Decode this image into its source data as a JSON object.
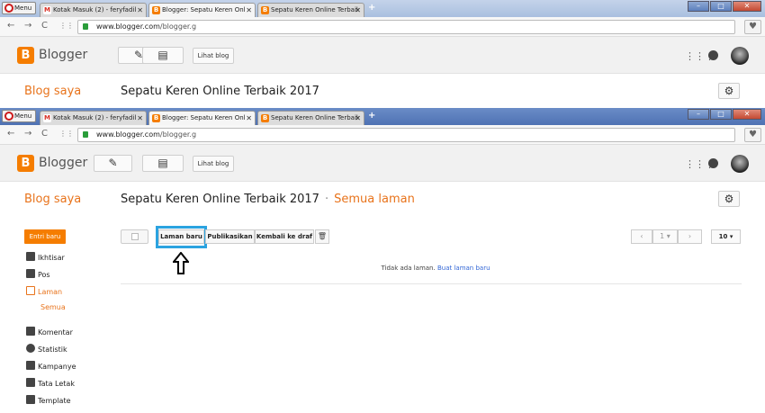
{
  "browser": {
    "menu_label": "Menu",
    "tabs": [
      {
        "title": "Kotak Masuk (2) - feryfadil",
        "icon": "gmail-icon"
      },
      {
        "title": "Blogger: Sepatu Keren Onl",
        "icon": "blogger-icon"
      },
      {
        "title": "Sepatu Keren Online Terbaik",
        "icon": "blogger-icon"
      }
    ],
    "close_glyph": "✕",
    "new_tab": "+",
    "url_domain": "www.blogger.com",
    "url_path": "/blogger.g"
  },
  "header": {
    "logo_letter": "B",
    "brand": "Blogger",
    "lihat_blog": "Lihat blog"
  },
  "subheader": {
    "blog_saya": "Blog saya",
    "blog_title": "Sepatu Keren Online Terbaik 2017",
    "separator": "·",
    "section": "Semua laman"
  },
  "sidebar": {
    "new_post": "Entri baru",
    "items": [
      {
        "label": "Ikhtisar",
        "icon": "home-icon"
      },
      {
        "label": "Pos",
        "icon": "posts-icon"
      },
      {
        "label": "Laman",
        "icon": "pages-icon"
      },
      {
        "label": "Semua",
        "icon": ""
      },
      {
        "label": "Komentar",
        "icon": "comment-icon"
      },
      {
        "label": "Statistik",
        "icon": "stats-icon"
      },
      {
        "label": "Kampanye",
        "icon": "campaign-icon"
      },
      {
        "label": "Tata Letak",
        "icon": "layout-icon"
      },
      {
        "label": "Template",
        "icon": "template-icon"
      }
    ]
  },
  "toolbar": {
    "new_page": "Laman baru",
    "publish": "Publikasikan",
    "revert_draft": "Kembali ke draf",
    "page_number": "1",
    "per_page": "10"
  },
  "content": {
    "empty_text": "Tidak ada laman.",
    "empty_link": "Buat laman baru"
  },
  "colors": {
    "accent_orange": "#f57d00",
    "highlight_blue": "#2ba3e0",
    "link_blue": "#3367d6"
  }
}
